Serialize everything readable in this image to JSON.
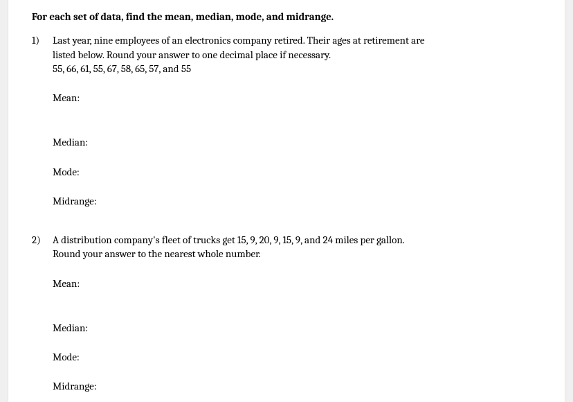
{
  "instructions": "For each set of data, find the mean, median, mode, and midrange.",
  "problems": [
    {
      "number": "1)",
      "text_line1": "Last year, nine employees of an electronics company retired. Their ages at retirement are",
      "text_line2": "listed below. Round your answer to one decimal place if necessary.",
      "data_line": "55, 66, 61, 55, 67, 58, 65, 57, and 55"
    },
    {
      "number": "2)",
      "text_line1": "A distribution company's fleet of trucks get 15, 9, 20, 9, 15, 9, and 24 miles per gallon.",
      "text_line2": "Round your answer to the nearest whole number."
    }
  ],
  "labels": {
    "mean": "Mean:",
    "median": "Median:",
    "mode": "Mode:",
    "midrange": "Midrange:"
  }
}
